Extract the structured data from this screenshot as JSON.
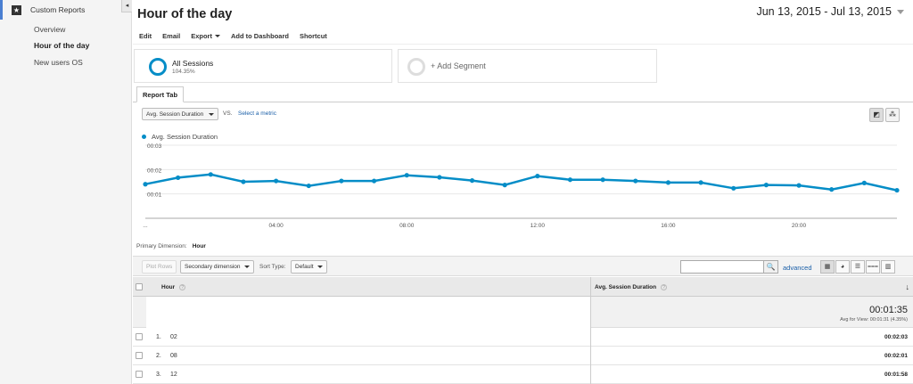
{
  "sidebar": {
    "section_title": "Custom Reports",
    "collapse_glyph": "◂",
    "items": [
      {
        "label": "Overview"
      },
      {
        "label": "Hour of the day"
      },
      {
        "label": "New users OS"
      }
    ]
  },
  "header": {
    "title": "Hour of the day",
    "date_range": "Jun 13, 2015 - Jul 13, 2015"
  },
  "toolbar": {
    "edit": "Edit",
    "email": "Email",
    "export": "Export",
    "add_to_dashboard": "Add to Dashboard",
    "shortcut": "Shortcut"
  },
  "segments": {
    "active_name": "All Sessions",
    "active_pct": "104.35%",
    "add_label": "+ Add Segment"
  },
  "tabs": {
    "report_tab": "Report Tab"
  },
  "chart_controls": {
    "metric": "Avg. Session Duration",
    "vs": "VS.",
    "select_metric": "Select a metric",
    "line_icon": "◩",
    "motion_icon": "⁂"
  },
  "chart_data": {
    "type": "line",
    "series": [
      {
        "name": "Avg. Session Duration",
        "color": "#058dc7",
        "values_sec": [
          84,
          100,
          108,
          90,
          92,
          80,
          92,
          92,
          106,
          101,
          93,
          82,
          104,
          95,
          95,
          92,
          88,
          88,
          74,
          82,
          81,
          71,
          87,
          69
        ]
      }
    ],
    "x": [
      0,
      1,
      2,
      3,
      4,
      5,
      6,
      7,
      8,
      9,
      10,
      11,
      12,
      13,
      14,
      15,
      16,
      17,
      18,
      19,
      20,
      21,
      22,
      23
    ],
    "x_tick_labels": [
      "...",
      "04:00",
      "08:00",
      "12:00",
      "16:00",
      "20:00"
    ],
    "x_tick_hours": [
      0,
      4,
      8,
      12,
      16,
      20
    ],
    "y_tick_labels": [
      "00:03",
      "00:02",
      "00:01"
    ],
    "y_tick_values_sec": [
      180,
      120,
      60
    ],
    "ylim_sec": [
      0,
      180
    ],
    "grid": true,
    "legend": "top-left"
  },
  "primary_dimension": {
    "label": "Primary Dimension:",
    "value": "Hour"
  },
  "table_controls": {
    "plot_rows": "Plot Rows",
    "secondary_dimension": "Secondary dimension",
    "sort_type_label": "Sort Type:",
    "sort_type_value": "Default",
    "search_icon": "🔍",
    "advanced": "advanced",
    "view_icons": [
      "▦",
      "◕",
      "☰",
      "⩶",
      "▥"
    ]
  },
  "table": {
    "columns": [
      "Hour",
      "Avg. Session Duration"
    ],
    "help_glyph": "?",
    "sort_arrow": "↓",
    "total_value": "00:01:35",
    "total_sub": "Avg for View: 00:01:31 (4.35%)",
    "rows": [
      {
        "num": "1.",
        "hour": "02",
        "value": "00:02:03"
      },
      {
        "num": "2.",
        "hour": "08",
        "value": "00:02:01"
      },
      {
        "num": "3.",
        "hour": "12",
        "value": "00:01:58"
      }
    ]
  }
}
